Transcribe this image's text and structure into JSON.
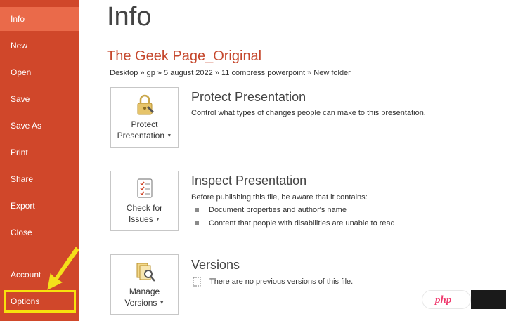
{
  "sidebar": {
    "items": [
      {
        "label": "Info",
        "active": true
      },
      {
        "label": "New"
      },
      {
        "label": "Open"
      },
      {
        "label": "Save"
      },
      {
        "label": "Save As"
      },
      {
        "label": "Print"
      },
      {
        "label": "Share"
      },
      {
        "label": "Export"
      },
      {
        "label": "Close"
      },
      {
        "label": "Account"
      },
      {
        "label": "Options",
        "highlighted": true
      }
    ]
  },
  "main": {
    "title": "Info",
    "document_title": "The Geek Page_Original",
    "breadcrumb": "Desktop » gp » 5 august 2022 » 11 compress powerpoint » New folder",
    "sections": [
      {
        "button_line1": "Protect",
        "button_line2": "Presentation",
        "heading": "Protect Presentation",
        "description": "Control what types of changes people can make to this presentation.",
        "icon": "lock-key-icon"
      },
      {
        "button_line1": "Check for",
        "button_line2": "Issues",
        "heading": "Inspect Presentation",
        "description": "Before publishing this file, be aware that it contains:",
        "bullets": [
          "Document properties and author's name",
          "Content that people with disabilities are unable to read"
        ],
        "icon": "checklist-icon"
      },
      {
        "button_line1": "Manage",
        "button_line2": "Versions",
        "heading": "Versions",
        "description": "There are no previous versions of this file.",
        "icon": "versions-search-icon"
      }
    ]
  },
  "watermark": {
    "text": "php"
  },
  "colors": {
    "sidebar": "#d0472a",
    "active_item": "#ea6a4a",
    "accent_title": "#c5472c",
    "highlight": "#f7e20d"
  }
}
